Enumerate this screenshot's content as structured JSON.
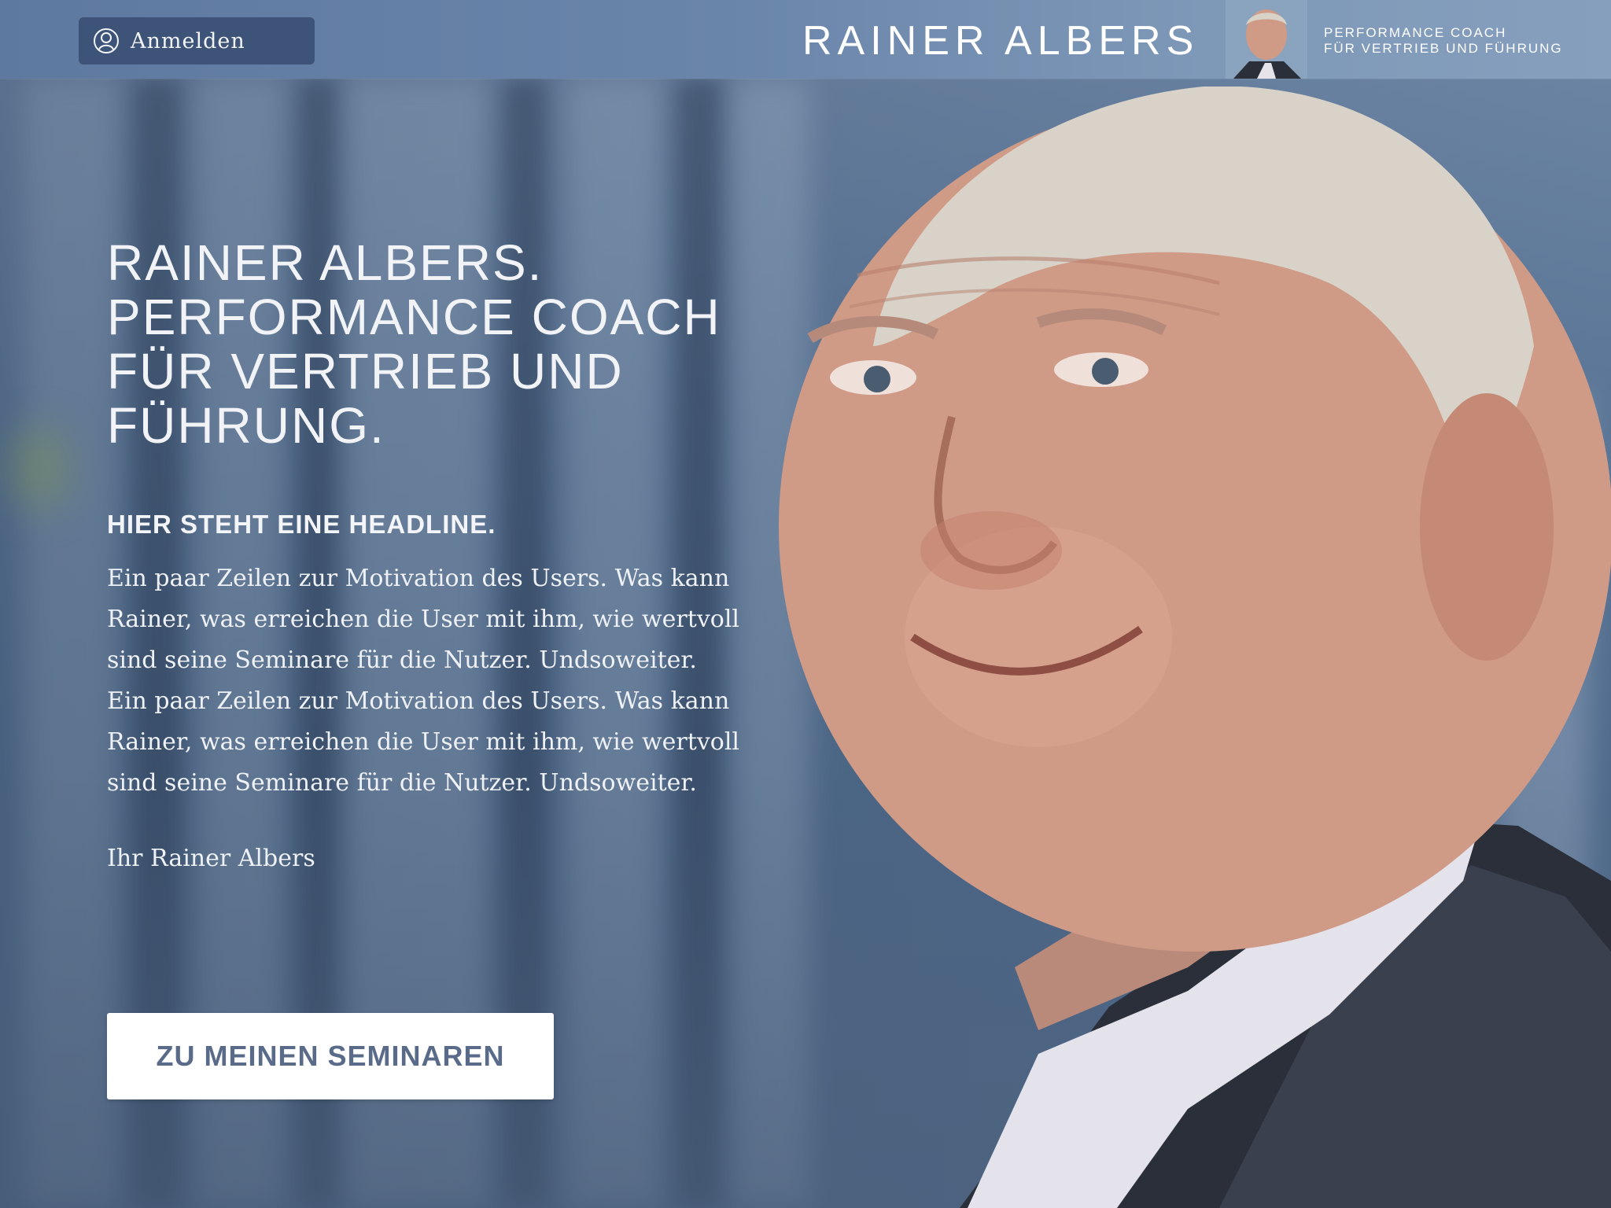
{
  "header": {
    "login_label": "Anmelden",
    "login_icon": "user-circle-icon",
    "brand_name": "RAINER ALBERS",
    "tagline_line1": "PERFORMANCE COACH",
    "tagline_line2": "FÜR VERTRIEB UND FÜHRUNG"
  },
  "hero": {
    "title_lines": [
      "RAINER ALBERS.",
      "PERFORMANCE COACH",
      "FÜR VERTRIEB UND",
      "FÜHRUNG."
    ],
    "subheadline": "HIER STEHT EINE HEADLINE.",
    "body_lines": [
      "Ein paar Zeilen zur Motivation des Users. Was kann",
      "Rainer, was erreichen die User mit ihm, wie wertvoll",
      "sind seine Seminare für die Nutzer. Undsoweiter.",
      "Ein paar Zeilen zur Motivation des Users. Was kann",
      "Rainer, was erreichen die User mit ihm, wie wertvoll",
      "sind seine Seminare für die Nutzer. Undsoweiter."
    ],
    "signature": "Ihr Rainer Albers",
    "cta_label": "ZU MEINEN SEMINAREN"
  },
  "colors": {
    "topbar": "#6a85aa",
    "login_button": "#3d5478",
    "background": "#5a7596",
    "cta_text": "#5a6b8a"
  }
}
